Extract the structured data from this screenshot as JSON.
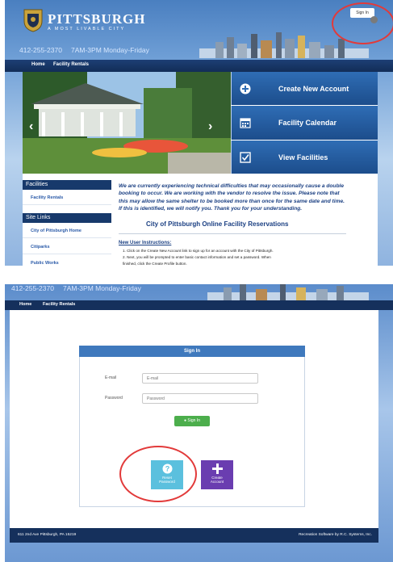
{
  "panel1": {
    "logo_name": "PITTSBURGH",
    "logo_tagline": "A MOST LIVABLE CITY",
    "phone": "412-255-2370",
    "hours": "7AM-3PM Monday-Friday",
    "sign_in_label": "Sign In",
    "nav": [
      "Home",
      "Facility Rentals"
    ],
    "tiles": [
      {
        "label": "Create New Account",
        "icon": "plus-circle-icon"
      },
      {
        "label": "Facility Calendar",
        "icon": "calendar-icon"
      },
      {
        "label": "View Facilities",
        "icon": "checkbox-icon"
      }
    ],
    "sidebar": {
      "facilities_header": "Facilities",
      "facilities_items": [
        "Facility Rentals"
      ],
      "site_links_header": "Site Links",
      "site_links_items": [
        "City of Pittsburgh Home",
        "Citiparks",
        "Public Works"
      ]
    },
    "notice": "We are currently experiencing technical difficulties that may occasionally cause a double booking to occur.  We are working with the vendor to resolve the issue.  Please note that this may allow the same shelter to be booked more than once for the same date and time.  If this is identified, we will notify you.  Thank you for your understanding.",
    "page_title": "City of Pittsburgh Online Facility Reservations",
    "instructions_header": "New User Instructions:",
    "instructions": [
      "1.  Click on the Create New Account link to sign up for an account with the City of Pittsburgh.",
      "2.  Next, you will be prompted to enter basic contact information and set a password.  When",
      "     finished, click the Create Profile button."
    ]
  },
  "panel2": {
    "phone": "412-255-2370",
    "hours": "7AM-3PM Monday-Friday",
    "nav": [
      "Home",
      "Facility Rentals"
    ],
    "card_title": "Sign In",
    "email_label": "E-mail",
    "email_placeholder": "E-mail",
    "password_label": "Password",
    "password_placeholder": "Password",
    "sign_in_button": "Sign In",
    "reset_tile": {
      "line1": "Reset",
      "line2": "Password",
      "icon": "question-circle-icon"
    },
    "create_tile": {
      "line1": "Create",
      "line2": "Account",
      "icon": "plus-icon"
    },
    "footer_left": "611 2nd Ave Pittsburgh, PA 15219",
    "footer_right": "Recreation Software by R.C. Systems, Inc."
  },
  "colors": {
    "nav_dark": "#15305c",
    "tile_blue": "#2f6db5",
    "sign_in_green": "#4cae4c",
    "reset_teal": "#5bc0de",
    "create_purple": "#6a3db0",
    "highlight_red": "#e23a3a"
  }
}
